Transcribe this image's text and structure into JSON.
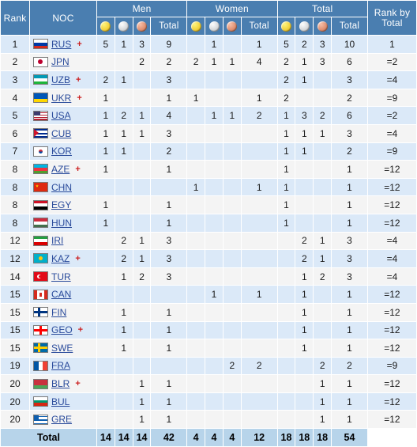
{
  "header": {
    "rank": "Rank",
    "noc": "NOC",
    "groups": [
      {
        "label": "Men"
      },
      {
        "label": "Women"
      },
      {
        "label": "Total"
      }
    ],
    "rank_by_total": "Rank by Total",
    "sub": {
      "gold_icon": "gold-medal-icon",
      "silver_icon": "silver-medal-icon",
      "bronze_icon": "bronze-medal-icon",
      "total": "Total"
    }
  },
  "colors": {
    "header_bg": "#4a7eb0",
    "row_odd": "#dbe9f8",
    "row_even": "#f4f4f4",
    "total_row": "#b7d4ea",
    "noc_link": "#2a4b9b",
    "plus_marker": "#cc2222",
    "gold": "#f2d13a",
    "silver": "#d6d8da",
    "bronze": "#de8f71"
  },
  "rows": [
    {
      "rank": "1",
      "code": "RUS",
      "plus": "+",
      "men_g": "5",
      "men_s": "1",
      "men_b": "3",
      "men_t": "9",
      "w_g": "",
      "w_s": "1",
      "w_b": "",
      "w_t": "1",
      "t_g": "5",
      "t_s": "2",
      "t_b": "3",
      "t_t": "10",
      "rbt": "1"
    },
    {
      "rank": "2",
      "code": "JPN",
      "plus": "",
      "men_g": "",
      "men_s": "",
      "men_b": "2",
      "men_t": "2",
      "w_g": "2",
      "w_s": "1",
      "w_b": "1",
      "w_t": "4",
      "t_g": "2",
      "t_s": "1",
      "t_b": "3",
      "t_t": "6",
      "rbt": "=2"
    },
    {
      "rank": "3",
      "code": "UZB",
      "plus": "+",
      "men_g": "2",
      "men_s": "1",
      "men_b": "",
      "men_t": "3",
      "w_g": "",
      "w_s": "",
      "w_b": "",
      "w_t": "",
      "t_g": "2",
      "t_s": "1",
      "t_b": "",
      "t_t": "3",
      "rbt": "=4"
    },
    {
      "rank": "4",
      "code": "UKR",
      "plus": "+",
      "men_g": "1",
      "men_s": "",
      "men_b": "",
      "men_t": "1",
      "w_g": "1",
      "w_s": "",
      "w_b": "",
      "w_t": "1",
      "t_g": "2",
      "t_s": "",
      "t_b": "",
      "t_t": "2",
      "rbt": "=9"
    },
    {
      "rank": "5",
      "code": "USA",
      "plus": "",
      "men_g": "1",
      "men_s": "2",
      "men_b": "1",
      "men_t": "4",
      "w_g": "",
      "w_s": "1",
      "w_b": "1",
      "w_t": "2",
      "t_g": "1",
      "t_s": "3",
      "t_b": "2",
      "t_t": "6",
      "rbt": "=2"
    },
    {
      "rank": "6",
      "code": "CUB",
      "plus": "",
      "men_g": "1",
      "men_s": "1",
      "men_b": "1",
      "men_t": "3",
      "w_g": "",
      "w_s": "",
      "w_b": "",
      "w_t": "",
      "t_g": "1",
      "t_s": "1",
      "t_b": "1",
      "t_t": "3",
      "rbt": "=4"
    },
    {
      "rank": "7",
      "code": "KOR",
      "plus": "",
      "men_g": "1",
      "men_s": "1",
      "men_b": "",
      "men_t": "2",
      "w_g": "",
      "w_s": "",
      "w_b": "",
      "w_t": "",
      "t_g": "1",
      "t_s": "1",
      "t_b": "",
      "t_t": "2",
      "rbt": "=9"
    },
    {
      "rank": "8",
      "code": "AZE",
      "plus": "+",
      "men_g": "1",
      "men_s": "",
      "men_b": "",
      "men_t": "1",
      "w_g": "",
      "w_s": "",
      "w_b": "",
      "w_t": "",
      "t_g": "1",
      "t_s": "",
      "t_b": "",
      "t_t": "1",
      "rbt": "=12"
    },
    {
      "rank": "8",
      "code": "CHN",
      "plus": "",
      "men_g": "",
      "men_s": "",
      "men_b": "",
      "men_t": "",
      "w_g": "1",
      "w_s": "",
      "w_b": "",
      "w_t": "1",
      "t_g": "1",
      "t_s": "",
      "t_b": "",
      "t_t": "1",
      "rbt": "=12"
    },
    {
      "rank": "8",
      "code": "EGY",
      "plus": "",
      "men_g": "1",
      "men_s": "",
      "men_b": "",
      "men_t": "1",
      "w_g": "",
      "w_s": "",
      "w_b": "",
      "w_t": "",
      "t_g": "1",
      "t_s": "",
      "t_b": "",
      "t_t": "1",
      "rbt": "=12"
    },
    {
      "rank": "8",
      "code": "HUN",
      "plus": "",
      "men_g": "1",
      "men_s": "",
      "men_b": "",
      "men_t": "1",
      "w_g": "",
      "w_s": "",
      "w_b": "",
      "w_t": "",
      "t_g": "1",
      "t_s": "",
      "t_b": "",
      "t_t": "1",
      "rbt": "=12"
    },
    {
      "rank": "12",
      "code": "IRI",
      "plus": "",
      "men_g": "",
      "men_s": "2",
      "men_b": "1",
      "men_t": "3",
      "w_g": "",
      "w_s": "",
      "w_b": "",
      "w_t": "",
      "t_g": "",
      "t_s": "2",
      "t_b": "1",
      "t_t": "3",
      "rbt": "=4"
    },
    {
      "rank": "12",
      "code": "KAZ",
      "plus": "+",
      "men_g": "",
      "men_s": "2",
      "men_b": "1",
      "men_t": "3",
      "w_g": "",
      "w_s": "",
      "w_b": "",
      "w_t": "",
      "t_g": "",
      "t_s": "2",
      "t_b": "1",
      "t_t": "3",
      "rbt": "=4"
    },
    {
      "rank": "14",
      "code": "TUR",
      "plus": "",
      "men_g": "",
      "men_s": "1",
      "men_b": "2",
      "men_t": "3",
      "w_g": "",
      "w_s": "",
      "w_b": "",
      "w_t": "",
      "t_g": "",
      "t_s": "1",
      "t_b": "2",
      "t_t": "3",
      "rbt": "=4"
    },
    {
      "rank": "15",
      "code": "CAN",
      "plus": "",
      "men_g": "",
      "men_s": "",
      "men_b": "",
      "men_t": "",
      "w_g": "",
      "w_s": "1",
      "w_b": "",
      "w_t": "1",
      "t_g": "",
      "t_s": "1",
      "t_b": "",
      "t_t": "1",
      "rbt": "=12"
    },
    {
      "rank": "15",
      "code": "FIN",
      "plus": "",
      "men_g": "",
      "men_s": "1",
      "men_b": "",
      "men_t": "1",
      "w_g": "",
      "w_s": "",
      "w_b": "",
      "w_t": "",
      "t_g": "",
      "t_s": "1",
      "t_b": "",
      "t_t": "1",
      "rbt": "=12"
    },
    {
      "rank": "15",
      "code": "GEO",
      "plus": "+",
      "men_g": "",
      "men_s": "1",
      "men_b": "",
      "men_t": "1",
      "w_g": "",
      "w_s": "",
      "w_b": "",
      "w_t": "",
      "t_g": "",
      "t_s": "1",
      "t_b": "",
      "t_t": "1",
      "rbt": "=12"
    },
    {
      "rank": "15",
      "code": "SWE",
      "plus": "",
      "men_g": "",
      "men_s": "1",
      "men_b": "",
      "men_t": "1",
      "w_g": "",
      "w_s": "",
      "w_b": "",
      "w_t": "",
      "t_g": "",
      "t_s": "1",
      "t_b": "",
      "t_t": "1",
      "rbt": "=12"
    },
    {
      "rank": "19",
      "code": "FRA",
      "plus": "",
      "men_g": "",
      "men_s": "",
      "men_b": "",
      "men_t": "",
      "w_g": "",
      "w_s": "",
      "w_b": "2",
      "w_t": "2",
      "t_g": "",
      "t_s": "",
      "t_b": "2",
      "t_t": "2",
      "rbt": "=9"
    },
    {
      "rank": "20",
      "code": "BLR",
      "plus": "+",
      "men_g": "",
      "men_s": "",
      "men_b": "1",
      "men_t": "1",
      "w_g": "",
      "w_s": "",
      "w_b": "",
      "w_t": "",
      "t_g": "",
      "t_s": "",
      "t_b": "1",
      "t_t": "1",
      "rbt": "=12"
    },
    {
      "rank": "20",
      "code": "BUL",
      "plus": "",
      "men_g": "",
      "men_s": "",
      "men_b": "1",
      "men_t": "1",
      "w_g": "",
      "w_s": "",
      "w_b": "",
      "w_t": "",
      "t_g": "",
      "t_s": "",
      "t_b": "1",
      "t_t": "1",
      "rbt": "=12"
    },
    {
      "rank": "20",
      "code": "GRE",
      "plus": "",
      "men_g": "",
      "men_s": "",
      "men_b": "1",
      "men_t": "1",
      "w_g": "",
      "w_s": "",
      "w_b": "",
      "w_t": "",
      "t_g": "",
      "t_s": "",
      "t_b": "1",
      "t_t": "1",
      "rbt": "=12"
    }
  ],
  "totals": {
    "label": "Total",
    "men_g": "14",
    "men_s": "14",
    "men_b": "14",
    "men_t": "42",
    "w_g": "4",
    "w_s": "4",
    "w_b": "4",
    "w_t": "12",
    "t_g": "18",
    "t_s": "18",
    "t_b": "18",
    "t_t": "54",
    "rbt": ""
  }
}
